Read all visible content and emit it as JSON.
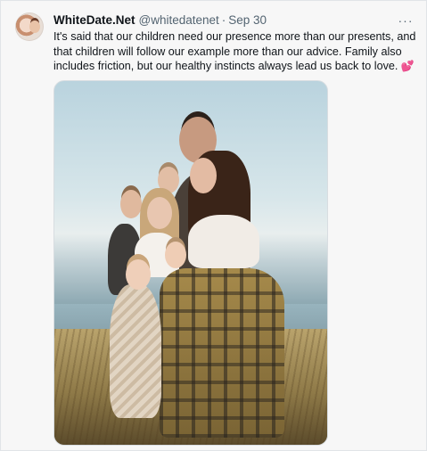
{
  "tweet": {
    "author_name": "WhiteDate.Net",
    "handle": "@whitedatenet",
    "separator": "·",
    "date": "Sep 30",
    "more_icon": "more-horizontal-icon",
    "more_glyph": "···",
    "text": "It's said that our children need our presence more than our presents, and that children will follow our example more than our advice. Family also includes friction, but our healthy instincts always lead us back to love.",
    "emoji": "💕",
    "emoji_name": "two-hearts-emoji",
    "media": {
      "kind": "photo",
      "alt": ""
    }
  },
  "colors": {
    "background": "#f7f7f7",
    "primary_text": "#0f1419",
    "secondary_text": "#536471",
    "heart": "#e0245e"
  }
}
